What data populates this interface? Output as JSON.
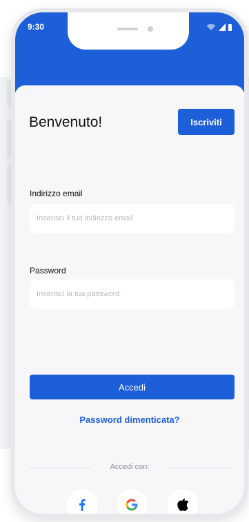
{
  "status_bar": {
    "time": "9:30"
  },
  "login": {
    "title": "Benvenuto!",
    "signup_label": "Iscriviti",
    "email_label": "Indirizzo email",
    "email_placeholder": "Inserisci il tuo indirizzo email",
    "password_label": "Password",
    "password_placeholder": "Inserisci la tua password",
    "login_label": "Accedi",
    "forgot_label": "Password dimenticata?",
    "social_label": "Accedi con:"
  },
  "social": [
    {
      "icon": "facebook-icon",
      "color": "#1877f2"
    },
    {
      "icon": "google-icon",
      "color": "#4285f4"
    },
    {
      "icon": "apple-icon",
      "color": "#000000"
    }
  ],
  "colors": {
    "primary": "#1d5fd8",
    "background": "#f7f7f9"
  }
}
